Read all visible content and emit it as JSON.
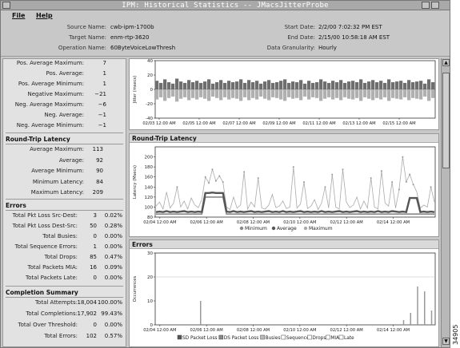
{
  "window": {
    "title": "IPM: Historical Statistics -- JMacsJitterProbe"
  },
  "menu": {
    "file": "File",
    "help": "Help"
  },
  "header": {
    "source_name_label": "Source Name:",
    "source_name": "cwb-ipm-1700b",
    "target_name_label": "Target Name:",
    "target_name": "enm-rtp-3620",
    "operation_name_label": "Operation Name:",
    "operation_name": "60ByteVoiceLowThresh",
    "start_date_label": "Start Date:",
    "start_date": "2/2/00 7:02:32 PM EST",
    "end_date_label": "End Date:",
    "end_date": "2/15/00 10:58:18 AM EST",
    "granularity_label": "Data Granularity:",
    "granularity": "Hourly"
  },
  "jitter_stats": [
    {
      "label": "Pos. Average Maximum:",
      "value": "7"
    },
    {
      "label": "Pos. Average:",
      "value": "1"
    },
    {
      "label": "Pos. Average Minimum:",
      "value": "1"
    },
    {
      "label": "Negative Maximum:",
      "value": "−21"
    },
    {
      "label": "Neg. Average Maximum:",
      "value": "−6"
    },
    {
      "label": "Neg. Average:",
      "value": "−1"
    },
    {
      "label": "Neg. Average Minimum:",
      "value": "−1"
    }
  ],
  "rtl_section": {
    "title": "Round-Trip Latency",
    "rows": [
      {
        "label": "Average Maximum:",
        "value": "113"
      },
      {
        "label": "Average:",
        "value": "92"
      },
      {
        "label": "Average Minimum:",
        "value": "90"
      },
      {
        "label": "Minimum Latency:",
        "value": "84"
      },
      {
        "label": "Maximum Latency:",
        "value": "209"
      }
    ]
  },
  "errors_section": {
    "title": "Errors",
    "rows": [
      {
        "label": "Total Pkt Loss Src-Dest:",
        "value": "3",
        "pct": "0.02%"
      },
      {
        "label": "Total Pkt Loss Dest-Src:",
        "value": "50",
        "pct": "0.28%"
      },
      {
        "label": "Total Busies:",
        "value": "0",
        "pct": "0.00%"
      },
      {
        "label": "Total Sequence Errors:",
        "value": "1",
        "pct": "0.00%"
      },
      {
        "label": "Total Drops:",
        "value": "85",
        "pct": "0.47%"
      },
      {
        "label": "Total Packets MIA:",
        "value": "16",
        "pct": "0.09%"
      },
      {
        "label": "Total Packets Late:",
        "value": "0",
        "pct": "0.00%"
      }
    ]
  },
  "completion_section": {
    "title": "Completion Summary",
    "rows": [
      {
        "label": "Total Attempts:",
        "value": "18,004",
        "pct": "100.00%"
      },
      {
        "label": "Total Completions:",
        "value": "17,902",
        "pct": "99.43%"
      },
      {
        "label": "Total Over Threshold:",
        "value": "0",
        "pct": "0.00%"
      },
      {
        "label": "Total Errors:",
        "value": "102",
        "pct": "0.57%"
      }
    ]
  },
  "panels": {
    "rtl_title": "Round-Trip Latency",
    "errors_title": "Errors"
  },
  "side_code": "34905",
  "colors": {
    "window_bg": "#c8c8c8",
    "jitter_pos": "#6e6e6e",
    "jitter_neg": "#b0b0b0",
    "min_line": "#888888",
    "avg_line": "#555555",
    "max_line": "#aaaaaa"
  },
  "chart_data": [
    {
      "type": "bar",
      "ylabel": "Jitter (msecs)",
      "ylim": [
        -40,
        40
      ],
      "yticks": [
        -40,
        -20,
        0,
        20,
        40
      ],
      "x_ticks": [
        "02/03 12:00 AM",
        "02/05 12:00 AM",
        "02/07 12:00 AM",
        "02/09 12:00 AM",
        "02/11 12:00 AM",
        "02/13 12:00 AM",
        "02/15 12:00 AM"
      ],
      "series": [
        {
          "values": [
            12,
            9,
            14,
            10,
            8,
            15,
            11,
            9,
            13,
            10,
            12,
            9,
            11,
            14,
            8,
            10,
            13,
            9,
            12,
            10,
            11,
            14,
            9,
            13,
            10,
            12,
            8,
            11,
            13,
            9,
            10,
            12,
            14,
            9,
            11,
            10,
            13,
            8,
            12,
            9,
            10,
            14,
            11,
            9,
            12,
            10,
            13,
            9,
            11,
            12,
            10,
            14,
            9,
            11,
            13,
            10,
            12,
            9,
            14,
            10,
            11,
            12,
            9,
            13,
            10,
            11,
            12,
            8,
            14,
            10
          ]
        },
        {
          "values": [
            -14,
            -11,
            -16,
            -12,
            -10,
            -17,
            -13,
            -11,
            -15,
            -12,
            -14,
            -11,
            -13,
            -16,
            -10,
            -12,
            -15,
            -11,
            -14,
            -12,
            -13,
            -16,
            -11,
            -15,
            -12,
            -14,
            -10,
            -13,
            -15,
            -11,
            -12,
            -14,
            -16,
            -11,
            -13,
            -12,
            -15,
            -10,
            -14,
            -11,
            -12,
            -16,
            -13,
            -11,
            -14,
            -12,
            -15,
            -11,
            -13,
            -14,
            -12,
            -16,
            -11,
            -13,
            -15,
            -12,
            -14,
            -11,
            -16,
            -12,
            -13,
            -14,
            -11,
            -15,
            -12,
            -13,
            -14,
            -10,
            -16,
            -12
          ]
        }
      ]
    },
    {
      "type": "line",
      "ylabel": "Latency (Msecs)",
      "ylim": [
        80,
        220
      ],
      "yticks": [
        80,
        100,
        120,
        140,
        160,
        180,
        200
      ],
      "x_ticks": [
        "02/04 12:00 AM",
        "02/06 12:00 AM",
        "02/08 12:00 AM",
        "02/10 12:00 AM",
        "02/12 12:00 AM",
        "02/14 12:00 AM"
      ],
      "series": [
        {
          "name": "Minimum",
          "values": [
            86,
            86,
            86,
            86,
            86,
            86,
            86,
            86,
            86,
            86,
            86,
            86,
            86,
            86,
            120,
            120,
            120,
            120,
            120,
            120,
            86,
            86,
            86,
            86,
            86,
            86,
            86,
            86,
            86,
            86,
            86,
            86,
            86,
            86,
            86,
            86,
            86,
            86,
            86,
            86,
            86,
            86,
            86,
            86,
            86,
            86,
            86,
            86,
            86,
            86,
            86,
            86,
            86,
            86,
            86,
            86,
            86,
            86,
            86,
            86,
            86,
            86,
            86,
            86,
            86,
            86,
            86,
            86,
            86,
            86,
            86,
            86,
            86,
            86,
            86,
            86,
            86,
            86,
            86,
            86
          ]
        },
        {
          "name": "Average",
          "values": [
            90,
            91,
            90,
            92,
            90,
            91,
            90,
            91,
            92,
            90,
            91,
            90,
            91,
            90,
            128,
            128,
            129,
            128,
            128,
            128,
            91,
            90,
            92,
            90,
            91,
            90,
            91,
            92,
            90,
            91,
            90,
            91,
            92,
            90,
            91,
            90,
            92,
            90,
            91,
            90,
            91,
            92,
            90,
            91,
            90,
            91,
            90,
            92,
            90,
            91,
            90,
            91,
            92,
            90,
            91,
            90,
            91,
            92,
            90,
            91,
            90,
            91,
            90,
            92,
            90,
            91,
            90,
            92,
            91,
            90,
            91,
            90,
            118,
            118,
            118,
            90,
            91,
            90,
            91,
            90
          ]
        },
        {
          "name": "Maximum",
          "values": [
            102,
            110,
            96,
            130,
            98,
            108,
            140,
            100,
            112,
            96,
            118,
            104,
            99,
            115,
            160,
            148,
            175,
            152,
            162,
            150,
            100,
            95,
            120,
            98,
            104,
            170,
            96,
            110,
            100,
            158,
            98,
            96,
            104,
            125,
            99,
            102,
            112,
            97,
            100,
            180,
            98,
            106,
            150,
            97,
            102,
            115,
            95,
            108,
            140,
            98,
            165,
            100,
            96,
            175,
            110,
            99,
            104,
            120,
            96,
            112,
            98,
            158,
            100,
            96,
            172,
            108,
            102,
            150,
            98,
            135,
            200,
            150,
            165,
            145,
            130,
            98,
            104,
            100,
            140,
            110
          ]
        }
      ]
    },
    {
      "type": "bar",
      "ylabel": "Occurrences",
      "ylim": [
        0,
        30
      ],
      "yticks": [
        0,
        10,
        20,
        30
      ],
      "x_ticks": [
        "02/04 12:00 AM",
        "02/06 12:00 AM",
        "02/08 12:00 AM",
        "02/10 12:00 AM",
        "02/12 12:00 AM",
        "02/14 12:00 AM"
      ],
      "legend": [
        "SD Packet Loss",
        "DS Packet Loss",
        "Busies",
        "Sequence",
        "Drops",
        "MIA",
        "Late"
      ],
      "series": [
        {
          "name": "SD Packet Loss",
          "values": [
            0,
            0,
            0,
            0,
            0,
            0,
            0,
            0,
            0,
            0,
            0,
            0,
            0,
            0,
            0,
            0,
            0,
            0,
            0,
            0,
            0,
            0,
            0,
            0,
            0,
            0,
            0,
            0,
            0,
            0,
            0,
            0,
            0,
            0,
            0,
            0,
            0,
            0,
            0,
            0
          ]
        },
        {
          "name": "Drops",
          "values": [
            0,
            0,
            0,
            0,
            0,
            0,
            10,
            0,
            0,
            0,
            0,
            0,
            0,
            0,
            0,
            0,
            0,
            0,
            0,
            0,
            0,
            0,
            0,
            0,
            0,
            0,
            0,
            0,
            0,
            0,
            0,
            0,
            0,
            0,
            0,
            2,
            5,
            16,
            14,
            6
          ]
        }
      ]
    }
  ]
}
